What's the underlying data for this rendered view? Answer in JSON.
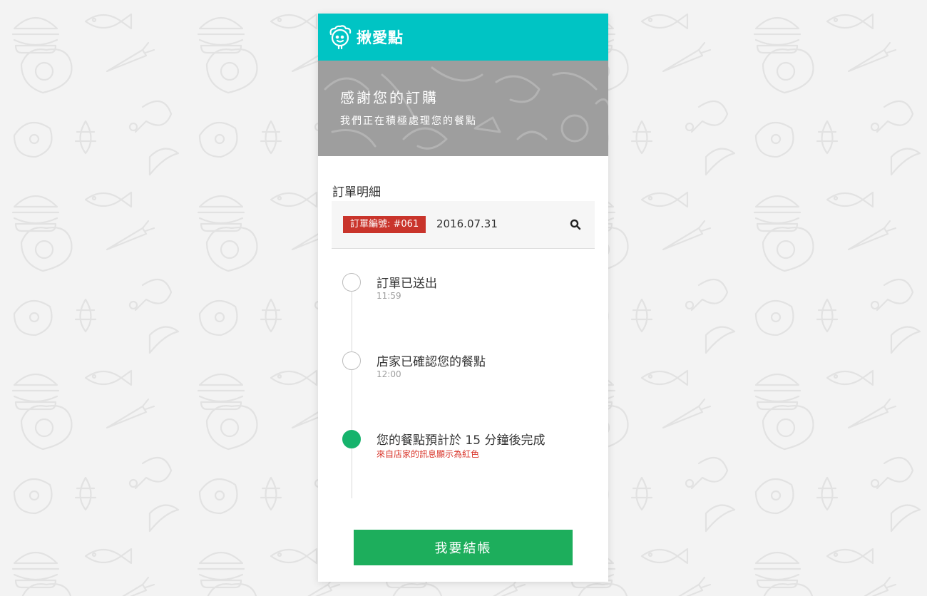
{
  "app": {
    "name": "揪愛點",
    "header_color": "#00c4c4"
  },
  "hero": {
    "title": "感謝您的訂購",
    "subtitle": "我們正在積極處理您的餐點"
  },
  "order": {
    "section_title": "訂單明細",
    "badge": "訂單編號: #061",
    "date": "2016.07.31",
    "badge_color": "#c9342b"
  },
  "timeline": [
    {
      "label": "訂單已送出",
      "time": "11:59",
      "status": "done"
    },
    {
      "label": "店家已確認您的餐點",
      "time": "12:00",
      "status": "done"
    },
    {
      "label": "您的餐點預計於 15 分鐘後完成",
      "note": "來自店家的訊息顯示為紅色",
      "status": "active"
    }
  ],
  "checkout": {
    "label": "我要結帳",
    "color": "#1dae5c"
  },
  "icons": {
    "logo": "bear-logo-icon",
    "search": "search-icon"
  }
}
